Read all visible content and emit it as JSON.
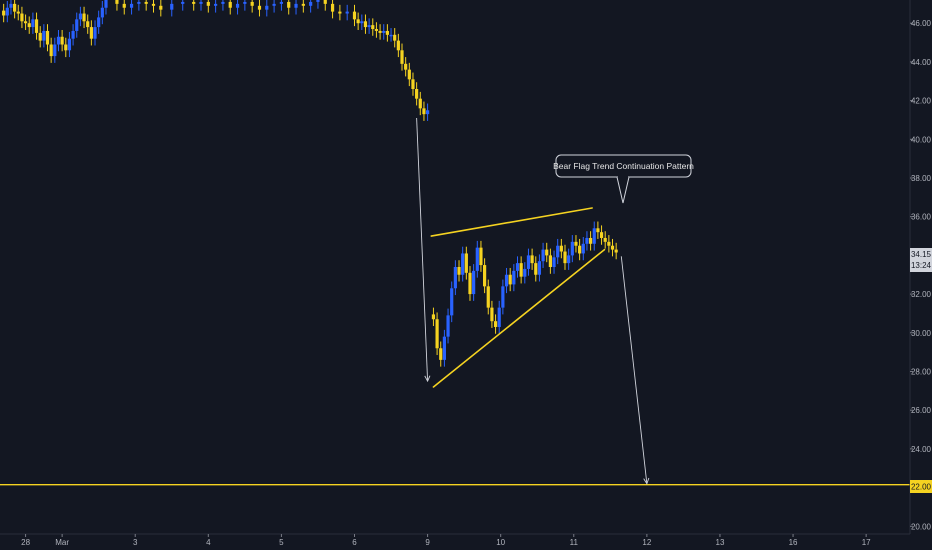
{
  "chart_data": {
    "type": "candlestick",
    "title": "",
    "xlabel": "",
    "ylabel": "",
    "ylim": [
      19.6,
      47.2
    ],
    "y_ticks": [
      "20.00",
      "22.00",
      "24.00",
      "26.00",
      "28.00",
      "30.00",
      "32.00",
      "34.00",
      "36.00",
      "38.00",
      "40.00",
      "42.00",
      "44.00",
      "46.00"
    ],
    "x_ticks": [
      "28",
      "Mar",
      "3",
      "4",
      "5",
      "6",
      "9",
      "10",
      "11",
      "12",
      "13",
      "16",
      "17"
    ],
    "x_tick_positions": [
      27.5,
      28,
      29,
      30,
      31,
      32,
      33,
      34,
      35,
      36,
      37,
      38,
      39
    ],
    "x_range": [
      27.15,
      39.6
    ],
    "colors": {
      "up": "#2962ff",
      "down": "#f5d321",
      "pattern": "#f5d321",
      "arrow": "#d1d4dc",
      "background": "#131722"
    },
    "last_price": "34.15",
    "countdown": "13:24",
    "current_price_label": "22.00",
    "support_level": 22.15,
    "annotation": "Bear Flag Trend Continuation Pattern",
    "flag_upper_line": [
      [
        33.05,
        35.0
      ],
      [
        35.25,
        36.45
      ]
    ],
    "flag_lower_line": [
      [
        33.08,
        27.2
      ],
      [
        35.42,
        34.3
      ]
    ],
    "arrow_1": [
      [
        32.85,
        41.1
      ],
      [
        33.0,
        27.5
      ]
    ],
    "arrow_2": [
      [
        35.65,
        33.95
      ],
      [
        36.0,
        22.2
      ]
    ],
    "candles": [
      {
        "x": 27.2,
        "c": 46.4
      },
      {
        "x": 27.25,
        "c": 46.8
      },
      {
        "x": 27.3,
        "c": 47.0
      },
      {
        "x": 27.35,
        "c": 46.6
      },
      {
        "x": 27.4,
        "c": 46.5
      },
      {
        "x": 27.45,
        "c": 46.1
      },
      {
        "x": 27.5,
        "c": 46.0
      },
      {
        "x": 27.55,
        "c": 45.8
      },
      {
        "x": 27.6,
        "c": 46.2
      },
      {
        "x": 27.65,
        "c": 45.5
      },
      {
        "x": 27.7,
        "c": 45.1
      },
      {
        "x": 27.75,
        "c": 45.6
      },
      {
        "x": 27.8,
        "c": 44.9
      },
      {
        "x": 27.85,
        "c": 44.3
      },
      {
        "x": 27.9,
        "c": 44.9
      },
      {
        "x": 27.95,
        "c": 45.3
      },
      {
        "x": 28.0,
        "c": 44.9
      },
      {
        "x": 28.05,
        "c": 44.6
      },
      {
        "x": 28.1,
        "c": 45.2
      },
      {
        "x": 28.15,
        "c": 45.6
      },
      {
        "x": 28.2,
        "c": 46.2
      },
      {
        "x": 28.25,
        "c": 46.5
      },
      {
        "x": 28.3,
        "c": 46.1
      },
      {
        "x": 28.35,
        "c": 45.8
      },
      {
        "x": 28.4,
        "c": 45.2
      },
      {
        "x": 28.45,
        "c": 45.8
      },
      {
        "x": 28.5,
        "c": 46.3
      },
      {
        "x": 28.55,
        "c": 46.8
      },
      {
        "x": 28.6,
        "c": 47.2
      },
      {
        "x": 28.75,
        "c": 47.0
      },
      {
        "x": 28.85,
        "c": 46.8
      },
      {
        "x": 28.95,
        "c": 47.0
      },
      {
        "x": 29.05,
        "c": 47.1
      },
      {
        "x": 29.15,
        "c": 47.0
      },
      {
        "x": 29.25,
        "c": 46.9
      },
      {
        "x": 29.35,
        "c": 46.7
      },
      {
        "x": 29.5,
        "c": 47.0
      },
      {
        "x": 29.65,
        "c": 47.1
      },
      {
        "x": 29.8,
        "c": 47.0
      },
      {
        "x": 29.9,
        "c": 47.1
      },
      {
        "x": 30.0,
        "c": 46.9
      },
      {
        "x": 30.1,
        "c": 47.0
      },
      {
        "x": 30.2,
        "c": 47.1
      },
      {
        "x": 30.3,
        "c": 46.8
      },
      {
        "x": 30.4,
        "c": 47.0
      },
      {
        "x": 30.5,
        "c": 47.1
      },
      {
        "x": 30.6,
        "c": 46.9
      },
      {
        "x": 30.7,
        "c": 46.7
      },
      {
        "x": 30.8,
        "c": 46.9
      },
      {
        "x": 30.9,
        "c": 47.0
      },
      {
        "x": 31.0,
        "c": 47.1
      },
      {
        "x": 31.1,
        "c": 46.8
      },
      {
        "x": 31.2,
        "c": 47.0
      },
      {
        "x": 31.3,
        "c": 46.9
      },
      {
        "x": 31.4,
        "c": 47.1
      },
      {
        "x": 31.5,
        "c": 47.2
      },
      {
        "x": 31.6,
        "c": 47.0
      },
      {
        "x": 31.7,
        "c": 46.6
      },
      {
        "x": 31.8,
        "c": 46.5
      },
      {
        "x": 31.9,
        "c": 46.6
      },
      {
        "x": 32.0,
        "c": 46.2
      },
      {
        "x": 32.05,
        "c": 46.0
      },
      {
        "x": 32.1,
        "c": 46.1
      },
      {
        "x": 32.15,
        "c": 45.8
      },
      {
        "x": 32.2,
        "c": 45.9
      },
      {
        "x": 32.25,
        "c": 45.7
      },
      {
        "x": 32.3,
        "c": 45.6
      },
      {
        "x": 32.35,
        "c": 45.5
      },
      {
        "x": 32.4,
        "c": 45.6
      },
      {
        "x": 32.45,
        "c": 45.4
      },
      {
        "x": 32.5,
        "c": 45.4
      },
      {
        "x": 32.55,
        "c": 45.1
      },
      {
        "x": 32.6,
        "c": 44.6
      },
      {
        "x": 32.65,
        "c": 43.9
      },
      {
        "x": 32.7,
        "c": 43.6
      },
      {
        "x": 32.75,
        "c": 43.1
      },
      {
        "x": 32.8,
        "c": 42.6
      },
      {
        "x": 32.85,
        "c": 42.1
      },
      {
        "x": 32.9,
        "c": 41.6
      },
      {
        "x": 32.95,
        "c": 41.3
      },
      {
        "x": 33.0,
        "c": 41.5
      },
      {
        "x": 33.08,
        "c": 30.7
      },
      {
        "x": 33.13,
        "c": 29.2
      },
      {
        "x": 33.18,
        "c": 28.6
      },
      {
        "x": 33.23,
        "c": 29.8
      },
      {
        "x": 33.28,
        "c": 30.9
      },
      {
        "x": 33.33,
        "c": 32.3
      },
      {
        "x": 33.38,
        "c": 33.4
      },
      {
        "x": 33.43,
        "c": 33.0
      },
      {
        "x": 33.48,
        "c": 34.1
      },
      {
        "x": 33.53,
        "c": 33.1
      },
      {
        "x": 33.58,
        "c": 32.0
      },
      {
        "x": 33.63,
        "c": 33.2
      },
      {
        "x": 33.68,
        "c": 34.4
      },
      {
        "x": 33.73,
        "c": 33.5
      },
      {
        "x": 33.78,
        "c": 32.4
      },
      {
        "x": 33.83,
        "c": 31.3
      },
      {
        "x": 33.88,
        "c": 30.6
      },
      {
        "x": 33.93,
        "c": 30.3
      },
      {
        "x": 33.98,
        "c": 31.3
      },
      {
        "x": 34.03,
        "c": 32.4
      },
      {
        "x": 34.08,
        "c": 33.0
      },
      {
        "x": 34.13,
        "c": 32.5
      },
      {
        "x": 34.18,
        "c": 33.2
      },
      {
        "x": 34.23,
        "c": 33.6
      },
      {
        "x": 34.28,
        "c": 32.9
      },
      {
        "x": 34.33,
        "c": 33.3
      },
      {
        "x": 34.38,
        "c": 34.0
      },
      {
        "x": 34.43,
        "c": 33.6
      },
      {
        "x": 34.48,
        "c": 33.0
      },
      {
        "x": 34.53,
        "c": 33.7
      },
      {
        "x": 34.58,
        "c": 34.3
      },
      {
        "x": 34.63,
        "c": 34.0
      },
      {
        "x": 34.68,
        "c": 33.4
      },
      {
        "x": 34.73,
        "c": 33.9
      },
      {
        "x": 34.78,
        "c": 34.5
      },
      {
        "x": 34.83,
        "c": 34.2
      },
      {
        "x": 34.88,
        "c": 33.6
      },
      {
        "x": 34.93,
        "c": 34.0
      },
      {
        "x": 34.98,
        "c": 34.7
      },
      {
        "x": 35.03,
        "c": 34.5
      },
      {
        "x": 35.08,
        "c": 34.1
      },
      {
        "x": 35.13,
        "c": 34.6
      },
      {
        "x": 35.18,
        "c": 34.9
      },
      {
        "x": 35.23,
        "c": 34.6
      },
      {
        "x": 35.28,
        "c": 35.4
      },
      {
        "x": 35.33,
        "c": 35.2
      },
      {
        "x": 35.38,
        "c": 34.9
      },
      {
        "x": 35.43,
        "c": 34.7
      },
      {
        "x": 35.48,
        "c": 34.5
      },
      {
        "x": 35.53,
        "c": 34.3
      },
      {
        "x": 35.58,
        "c": 34.15
      }
    ]
  }
}
